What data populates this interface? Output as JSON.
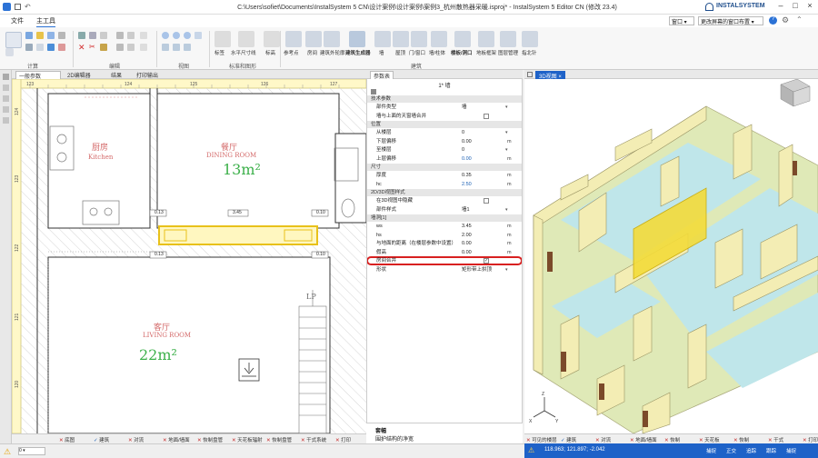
{
  "window": {
    "title": "C:\\Users\\sofiet\\Documents\\InstalSystem 5 CN\\设计案例\\设计案例\\案例3_杭州散热器采暖.isproj* - InstalSystem 5 Editor CN (修改 23.4)",
    "brand": "INSTALSYSTEM",
    "dropdowns": [
      "窗口",
      "更改屏幕的窗口布置"
    ]
  },
  "menu": [
    "文件",
    "主工具"
  ],
  "ribbon": {
    "groups": [
      "计算",
      "编辑",
      "视图",
      "标准和图形",
      "建筑"
    ],
    "buttons": [
      "标签",
      "水平尺寸线",
      "标高",
      "参考点",
      "房间",
      "建筑外轮廓",
      "建筑生成器",
      "墙",
      "屋顶",
      "门/窗口",
      "墙/柱体",
      "楼板/洞口",
      "地板框架",
      "图层管理",
      "指北针"
    ]
  },
  "plan": {
    "tabs": [
      "一般参数",
      "2D编辑器",
      "结果",
      "打印输出"
    ],
    "ruler_top": [
      "123",
      "124",
      "125",
      "126",
      "127"
    ],
    "ruler_left": [
      "124",
      "123",
      "122",
      "121",
      "120"
    ],
    "rooms": [
      {
        "cn": "厨房",
        "en": "Kitchen"
      },
      {
        "cn": "餐厅",
        "en": "DINING ROOM",
        "area": "13m²"
      },
      {
        "cn": "客厅",
        "en": "LIVING ROOM",
        "area": "22m²"
      }
    ],
    "tags": [
      "0.13",
      "3.45",
      "0.10",
      "0.13",
      "0.10"
    ],
    "stair": "LP"
  },
  "props": {
    "header": "参数表",
    "title": "1* 墙",
    "rows": [
      {
        "type": "cat",
        "label": "技术参数"
      },
      {
        "label": "部件类型",
        "value": "墙",
        "dd": true
      },
      {
        "label": "墙与上面的天窗墙合并",
        "checkbox": true
      },
      {
        "type": "cat",
        "label": "位置"
      },
      {
        "label": "从楼层",
        "value": "0",
        "dd": true
      },
      {
        "label": "下层偏移",
        "value": "0.00",
        "unit": "m"
      },
      {
        "label": "至楼层",
        "value": "0",
        "dd": true
      },
      {
        "label": "上层偏移",
        "value": "0.00",
        "unit": "m",
        "blue": true
      },
      {
        "type": "cat",
        "label": "尺寸"
      },
      {
        "label": "厚度",
        "value": "0.35",
        "unit": "m"
      },
      {
        "label": "hc",
        "value": "2.50",
        "unit": "m",
        "blue": true
      },
      {
        "type": "cat",
        "label": "2D/3D视图样式"
      },
      {
        "label": "在3D视图中隐藏",
        "checkbox": true
      },
      {
        "label": "部件样式",
        "value": "墙1",
        "dd": true
      },
      {
        "type": "cat",
        "label": "墙洞[1]"
      },
      {
        "label": "ws",
        "value": "3.45",
        "unit": "m"
      },
      {
        "label": "hs",
        "value": "2.00",
        "unit": "m"
      },
      {
        "label": "与地面的距离（在楼层参数中设置）",
        "value": "0.00",
        "unit": "m"
      },
      {
        "label": "假高",
        "value": "0.00",
        "unit": "m"
      },
      {
        "label": "房间合并",
        "checkbox": true,
        "checked": true,
        "highlight": true
      },
      {
        "label": "形状",
        "value": "矩形带上拱顶",
        "dd": true
      }
    ],
    "desc_title": "套幅",
    "desc_text": "围护结构的净宽"
  },
  "view3d": {
    "tab": "3D视图"
  },
  "status": {
    "plan_layers": [
      "底图",
      "建筑",
      "对流",
      "地面/墙面",
      "恢制盘管",
      "天花板辐射",
      "恢制盘管",
      "干式系统",
      "打印"
    ],
    "coords": "118.963; 121.897; -2.042",
    "view_tabs": [
      "可见的楼层",
      "建筑",
      "对流",
      "地面/墙面",
      "恢制",
      "天花板",
      "恢制",
      "干式",
      "打印"
    ],
    "right": [
      "捕捉",
      "正交",
      "追踪",
      "跟踪",
      "捕捉"
    ]
  }
}
